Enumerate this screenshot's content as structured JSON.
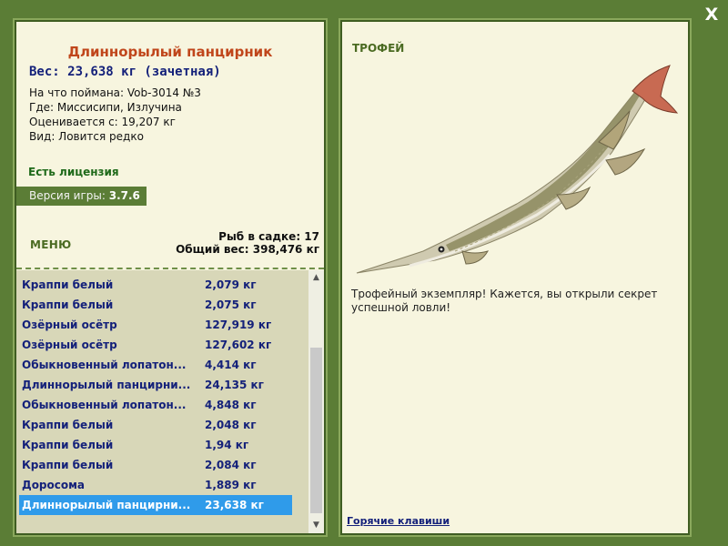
{
  "close": {
    "label": "X"
  },
  "fish": {
    "name": "Длиннорылый панцирник",
    "weight_line": "Вес: 23,638 кг (зачетная)",
    "caught_with": "На что поймана: Vob-3014 №3",
    "location": "Где: Миссисипи, Излучина",
    "rated_from": "Оценивается с: 19,207 кг",
    "rarity": "Вид: Ловится редко"
  },
  "license": {
    "text": "Есть лицензия"
  },
  "version": {
    "label": "Версия игры:",
    "value": "3.7.6"
  },
  "menu": {
    "label": "МЕНЮ"
  },
  "cage": {
    "count_line": "Рыб в садке: 17",
    "total_line": "Общий вес: 398,476 кг"
  },
  "catch_list": [
    {
      "name": "Краппи белый",
      "weight": "2,079 кг"
    },
    {
      "name": "Краппи белый",
      "weight": "2,075 кг"
    },
    {
      "name": "Озёрный осётр",
      "weight": "127,919 кг"
    },
    {
      "name": "Озёрный осётр",
      "weight": "127,602 кг"
    },
    {
      "name": "Обыкновенный лопатон...",
      "weight": "4,414 кг"
    },
    {
      "name": "Длиннорылый панцирни...",
      "weight": "24,135 кг"
    },
    {
      "name": "Обыкновенный лопатон...",
      "weight": "4,848 кг"
    },
    {
      "name": "Краппи белый",
      "weight": "2,048 кг"
    },
    {
      "name": "Краппи белый",
      "weight": "1,94 кг"
    },
    {
      "name": "Краппи белый",
      "weight": "2,084 кг"
    },
    {
      "name": "Доросома",
      "weight": "1,889 кг"
    },
    {
      "name": "Длиннорылый панцирни...",
      "weight": "23,638 кг",
      "selected": true
    }
  ],
  "trophy": {
    "label": "ТРОФЕЙ",
    "text": "Трофейный экземпляр! Кажется, вы открыли секрет успешной ловли!"
  },
  "hotkeys": {
    "label": "Горячие клавиши"
  },
  "colors": {
    "frame_green": "#5b7d36",
    "panel_bg": "#f7f5df",
    "list_bg": "#d8d7b8",
    "title_orange": "#c0461b",
    "text_navy": "#14217a",
    "selection_blue": "#2f9bea"
  }
}
